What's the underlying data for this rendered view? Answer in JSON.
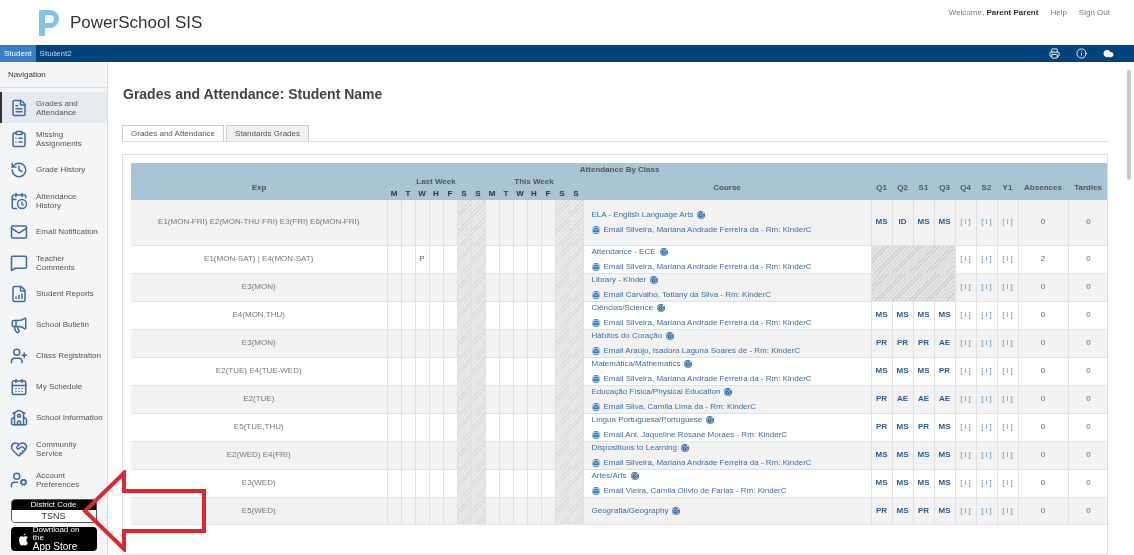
{
  "header": {
    "app_name": "PowerSchool SIS",
    "welcome": "Welcome,",
    "user": "Parent Parent",
    "links": [
      "Help",
      "Sign Out"
    ]
  },
  "student_tabs": [
    {
      "label": "Student",
      "selected": true
    },
    {
      "label": "Student2",
      "selected": false
    }
  ],
  "sidebar": {
    "title": "Navigation",
    "items": [
      {
        "label": "Grades and Attendance",
        "selected": true
      },
      {
        "label": "Missing Assignments",
        "selected": false
      },
      {
        "label": "Grade History",
        "selected": false
      },
      {
        "label": "Attendance History",
        "selected": false
      },
      {
        "label": "Email Notification",
        "selected": false
      },
      {
        "label": "Teacher Comments",
        "selected": false
      },
      {
        "label": "Student Reports",
        "selected": false
      },
      {
        "label": "School Bulletin",
        "selected": false
      },
      {
        "label": "Class Registration",
        "selected": false
      },
      {
        "label": "My Schedule",
        "selected": false
      },
      {
        "label": "School Information",
        "selected": false
      },
      {
        "label": "Community Service",
        "selected": false
      },
      {
        "label": "Account Preferences",
        "selected": false
      }
    ],
    "district_code": {
      "label": "District Code",
      "value": "TSNS"
    },
    "app_store": {
      "line1": "Download on the",
      "line2": "App Store"
    }
  },
  "page": {
    "title": "Grades and Attendance: Student Name",
    "tabs": [
      {
        "label": "Grades and Attendance",
        "selected": true
      },
      {
        "label": "Standards Grades",
        "selected": false
      }
    ]
  },
  "table": {
    "caption": "Attendance By Class",
    "columns": {
      "exp": "Exp",
      "last_week": "Last Week",
      "this_week": "This Week",
      "days": [
        "M",
        "T",
        "W",
        "H",
        "F",
        "S",
        "S",
        "M",
        "T",
        "W",
        "H",
        "F",
        "S",
        "S"
      ],
      "course": "Course",
      "terms": [
        "Q1",
        "Q2",
        "S1",
        "Q3",
        "Q4",
        "S2",
        "Y1"
      ],
      "absences": "Absences",
      "tardies": "Tardies"
    },
    "rows": [
      {
        "exp": "E1(MON-FRI) E2(MON-THU FRI) E3(FRI) E6(MON-FRI)",
        "course": "ELA - English Language Arts",
        "email": "Email",
        "teacher": "Silveira, Mariana Andrade Ferreira da - Rm: KinderC",
        "grades_hatched": false,
        "grades": [
          "MS",
          "ID",
          "MS",
          "MS",
          "[ i ]",
          "[ i ]",
          "[ i ]"
        ],
        "absences": "0",
        "tardies": "0"
      },
      {
        "exp": "E1(MON-SAT) | E4(MON-SAT)",
        "attendance": [
          {
            "kind": "blank"
          },
          {
            "kind": "blank"
          },
          {
            "kind": "mark",
            "code": "P"
          }
        ],
        "course": "Attendance - ECE",
        "email": "Email",
        "teacher": "Silveira, Mariana Andrade Ferreira da - Rm: KinderC",
        "grades_hatched": true,
        "grades": [
          "[ i ]",
          "[ i ]",
          "[ i ]"
        ],
        "absences": "2",
        "tardies": "0"
      },
      {
        "exp": "E3(MON)",
        "course": "Library - Kinder",
        "email": "Email",
        "teacher": "Carvalho, Tatiany da Silva - Rm: KinderC",
        "grades_hatched": true,
        "grades": [
          "[ i ]",
          "[ i ]",
          "[ i ]"
        ],
        "absences": "0",
        "tardies": "0"
      },
      {
        "exp": "E4(MON,THU)",
        "course": "Ciências/Science",
        "email": "Email",
        "teacher": "Silveira, Mariana Andrade Ferreira da - Rm: KinderC",
        "grades_hatched": false,
        "grades": [
          "MS",
          "MS",
          "MS",
          "MS",
          "[ i ]",
          "[ i ]",
          "[ i ]"
        ],
        "absences": "0",
        "tardies": "0"
      },
      {
        "exp": "E3(MON)",
        "course": "Hábitos do Coração",
        "email": "Email",
        "teacher": "Araújo, Isadora Laguna Soares de - Rm: KinderC",
        "grades_hatched": false,
        "grades": [
          "PR",
          "PR",
          "PR",
          "AE",
          "[ i ]",
          "[ i ]",
          "[ i ]"
        ],
        "absences": "0",
        "tardies": "0"
      },
      {
        "exp": "E2(TUE) E4(TUE-WED)",
        "course": "Matemática/Mathematics",
        "email": "Email",
        "teacher": "Silveira, Mariana Andrade Ferreira da - Rm: KinderC",
        "grades_hatched": false,
        "grades": [
          "MS",
          "MS",
          "MS",
          "PR",
          "[ i ]",
          "[ i ]",
          "[ i ]"
        ],
        "absences": "0",
        "tardies": "0"
      },
      {
        "exp": "E2(TUE)",
        "course": "Educação Física/Physical Education",
        "email": "Email",
        "teacher": "Silva, Camila Lima da - Rm: KinderC",
        "grades_hatched": false,
        "grades": [
          "PR",
          "AE",
          "AE",
          "AE",
          "[ i ]",
          "[ i ]",
          "[ i ]"
        ],
        "absences": "0",
        "tardies": "0"
      },
      {
        "exp": "E5(TUE,THU)",
        "course": "Língua Portuguesa/Portuguese",
        "email": "Email",
        "teacher": "Ani, Jaqueline Rosane Moraes - Rm: KinderC",
        "grades_hatched": false,
        "grades": [
          "PR",
          "MS",
          "PR",
          "MS",
          "[ i ]",
          "[ i ]",
          "[ i ]"
        ],
        "absences": "0",
        "tardies": "0"
      },
      {
        "exp": "E2(WED) E4(FRI)",
        "course": "Dispositions to Learning",
        "email": "Email",
        "teacher": "Silveira, Mariana Andrade Ferreira da - Rm: KinderC",
        "grades_hatched": false,
        "grades": [
          "MS",
          "MS",
          "MS",
          "MS",
          "[ i ]",
          "[ i ]",
          "[ i ]"
        ],
        "absences": "0",
        "tardies": "0"
      },
      {
        "exp": "E3(WED)",
        "course": "Artes/Arts",
        "email": "Email",
        "teacher": "Vieira, Camila Olívio de Farias - Rm: KinderC",
        "grades_hatched": false,
        "grades": [
          "MS",
          "MS",
          "MS",
          "MS",
          "[ i ]",
          "[ i ]",
          "[ i ]"
        ],
        "absences": "0",
        "tardies": "0"
      },
      {
        "exp": "E5(WED)",
        "course": "Geografia/Geography",
        "grades_hatched": false,
        "grades": [
          "PR",
          "MS",
          "PR",
          "MS",
          "[ i ]",
          "[ i ]",
          "[ i ]"
        ],
        "absences": "0",
        "tardies": "0"
      }
    ]
  }
}
